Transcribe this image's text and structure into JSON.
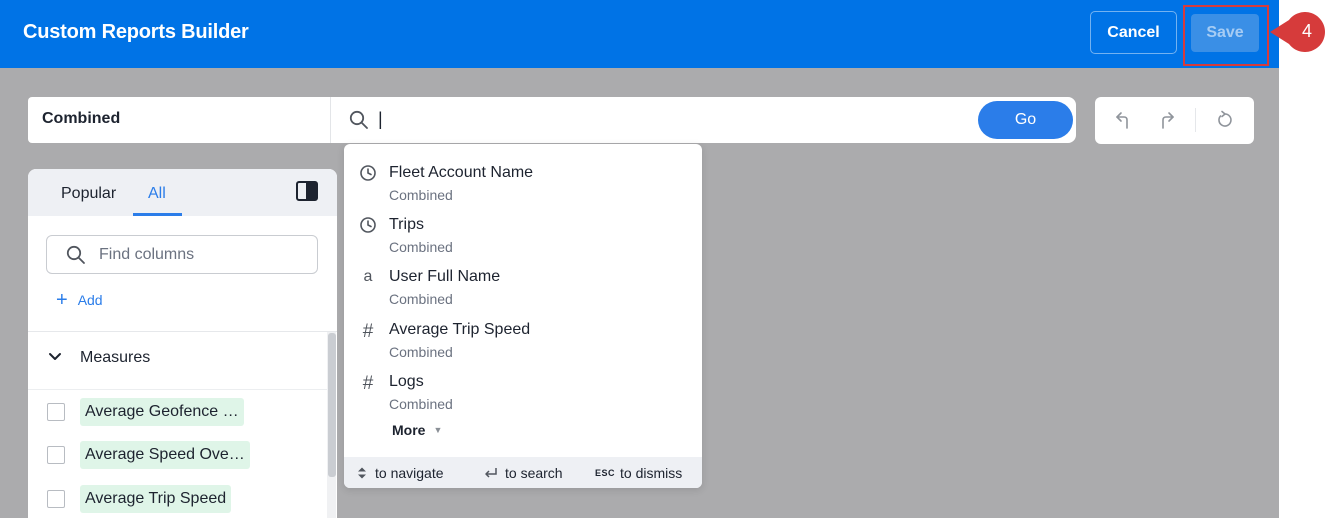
{
  "header": {
    "title": "Custom Reports Builder",
    "cancel_label": "Cancel",
    "save_label": "Save",
    "callout_number": "4",
    "brand_color": "#0073e6",
    "highlight_color": "#d63b3b"
  },
  "toolbar": {
    "worksheet_name": "Combined",
    "search_value": "|",
    "go_label": "Go"
  },
  "history": {
    "undo_icon": "undo-icon",
    "redo_icon": "redo-icon",
    "reset_icon": "reset-icon"
  },
  "left_panel": {
    "tabs": [
      {
        "label": "Popular",
        "active": false
      },
      {
        "label": "All",
        "active": true
      }
    ],
    "find_placeholder": "Find columns",
    "add_label": "Add",
    "measures_header": "Measures",
    "measures": [
      {
        "label": "Average Geofence …",
        "checked": false
      },
      {
        "label": "Average Speed Ove…",
        "checked": false
      },
      {
        "label": "Average Trip Speed",
        "checked": false
      }
    ]
  },
  "dropdown": {
    "items": [
      {
        "icon": "clock-icon",
        "name": "Fleet Account Name",
        "source": "Combined"
      },
      {
        "icon": "clock-icon",
        "name": "Trips",
        "source": "Combined"
      },
      {
        "icon": "text-attribute-icon",
        "glyph": "a",
        "name": "User Full Name",
        "source": "Combined"
      },
      {
        "icon": "hash-icon",
        "glyph": "#",
        "name": "Average Trip Speed",
        "source": "Combined"
      },
      {
        "icon": "hash-icon",
        "glyph": "#",
        "name": "Logs",
        "source": "Combined"
      }
    ],
    "more_label": "More",
    "footer": {
      "navigate_label": "to navigate",
      "search_label": "to search",
      "esc_key": "ESC",
      "dismiss_label": "to dismiss"
    }
  }
}
